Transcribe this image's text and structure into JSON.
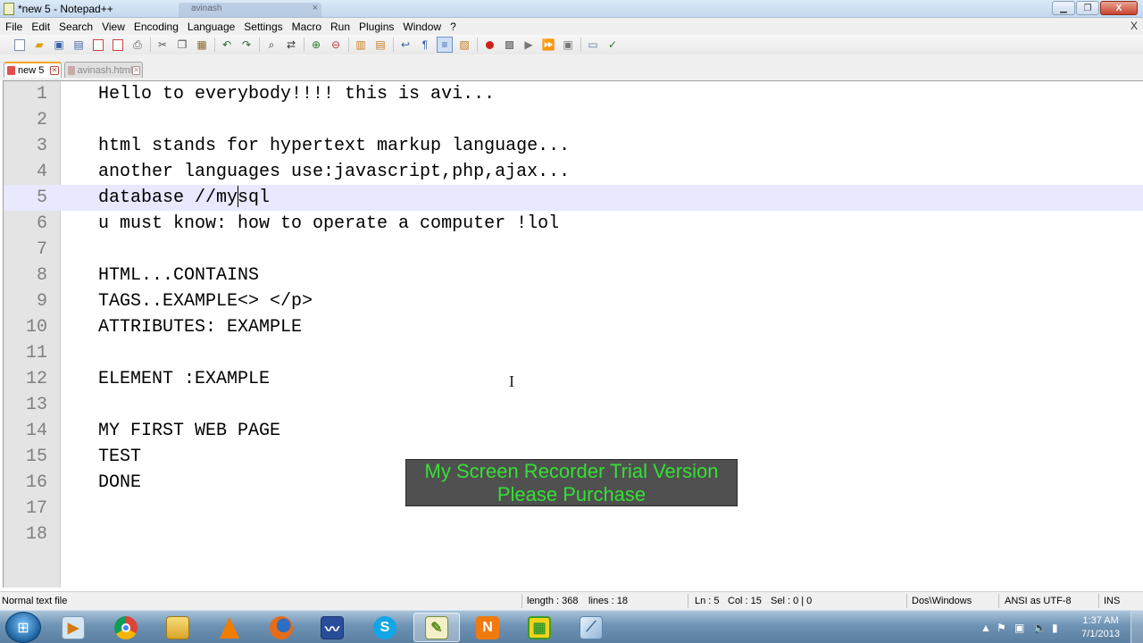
{
  "window": {
    "title": "*new  5 - Notepad++",
    "ghost_tab_label": "avinash",
    "min_label": "▁",
    "max_label": "❐",
    "close_label": "X"
  },
  "menubar": {
    "items": [
      "File",
      "Edit",
      "Search",
      "View",
      "Encoding",
      "Language",
      "Settings",
      "Macro",
      "Run",
      "Plugins",
      "Window",
      "?"
    ],
    "close_label": "X"
  },
  "tabs": [
    {
      "label": "new  5",
      "active": true
    },
    {
      "label": "avinash.html",
      "active": false
    }
  ],
  "editor": {
    "lines": [
      "Hello to everybody!!!! this is avi...",
      "",
      "html stands for hypertext markup language...",
      "another languages use:javascript,php,ajax...",
      "database //mysql",
      "u must know: how to operate a computer !lol",
      "",
      "HTML...CONTAINS",
      "TAGS..EXAMPLE<> </p>",
      "ATTRIBUTES: EXAMPLE",
      "",
      "ELEMENT :EXAMPLE",
      "",
      "MY FIRST WEB PAGE",
      "TEST",
      "DONE",
      "",
      ""
    ],
    "current_line": 5
  },
  "watermark": {
    "line1": "My Screen Recorder Trial Version",
    "line2": "Please Purchase"
  },
  "statusbar": {
    "file_type": "Normal text file",
    "length": "length : 368",
    "lines": "lines : 18",
    "ln": "Ln : 5",
    "col": "Col : 15",
    "sel": "Sel : 0 | 0",
    "eol": "Dos\\Windows",
    "encoding": "ANSI as UTF-8",
    "mode": "INS"
  },
  "taskbar": {
    "apps": [
      "start-menu",
      "media-player",
      "chrome",
      "explorer",
      "vlc",
      "firefox",
      "messenger",
      "skype",
      "notepad-plus-plus",
      "n-app",
      "green-app",
      "ink-app"
    ],
    "n_app_label": "N",
    "skype_label": "S",
    "clock_time": "1:37 AM",
    "clock_date": "7/1/2013"
  },
  "colors": {
    "watermark_text": "#34e034",
    "current_line_bg": "#e8e8ff",
    "gutter_bg": "#e4e4e4"
  }
}
